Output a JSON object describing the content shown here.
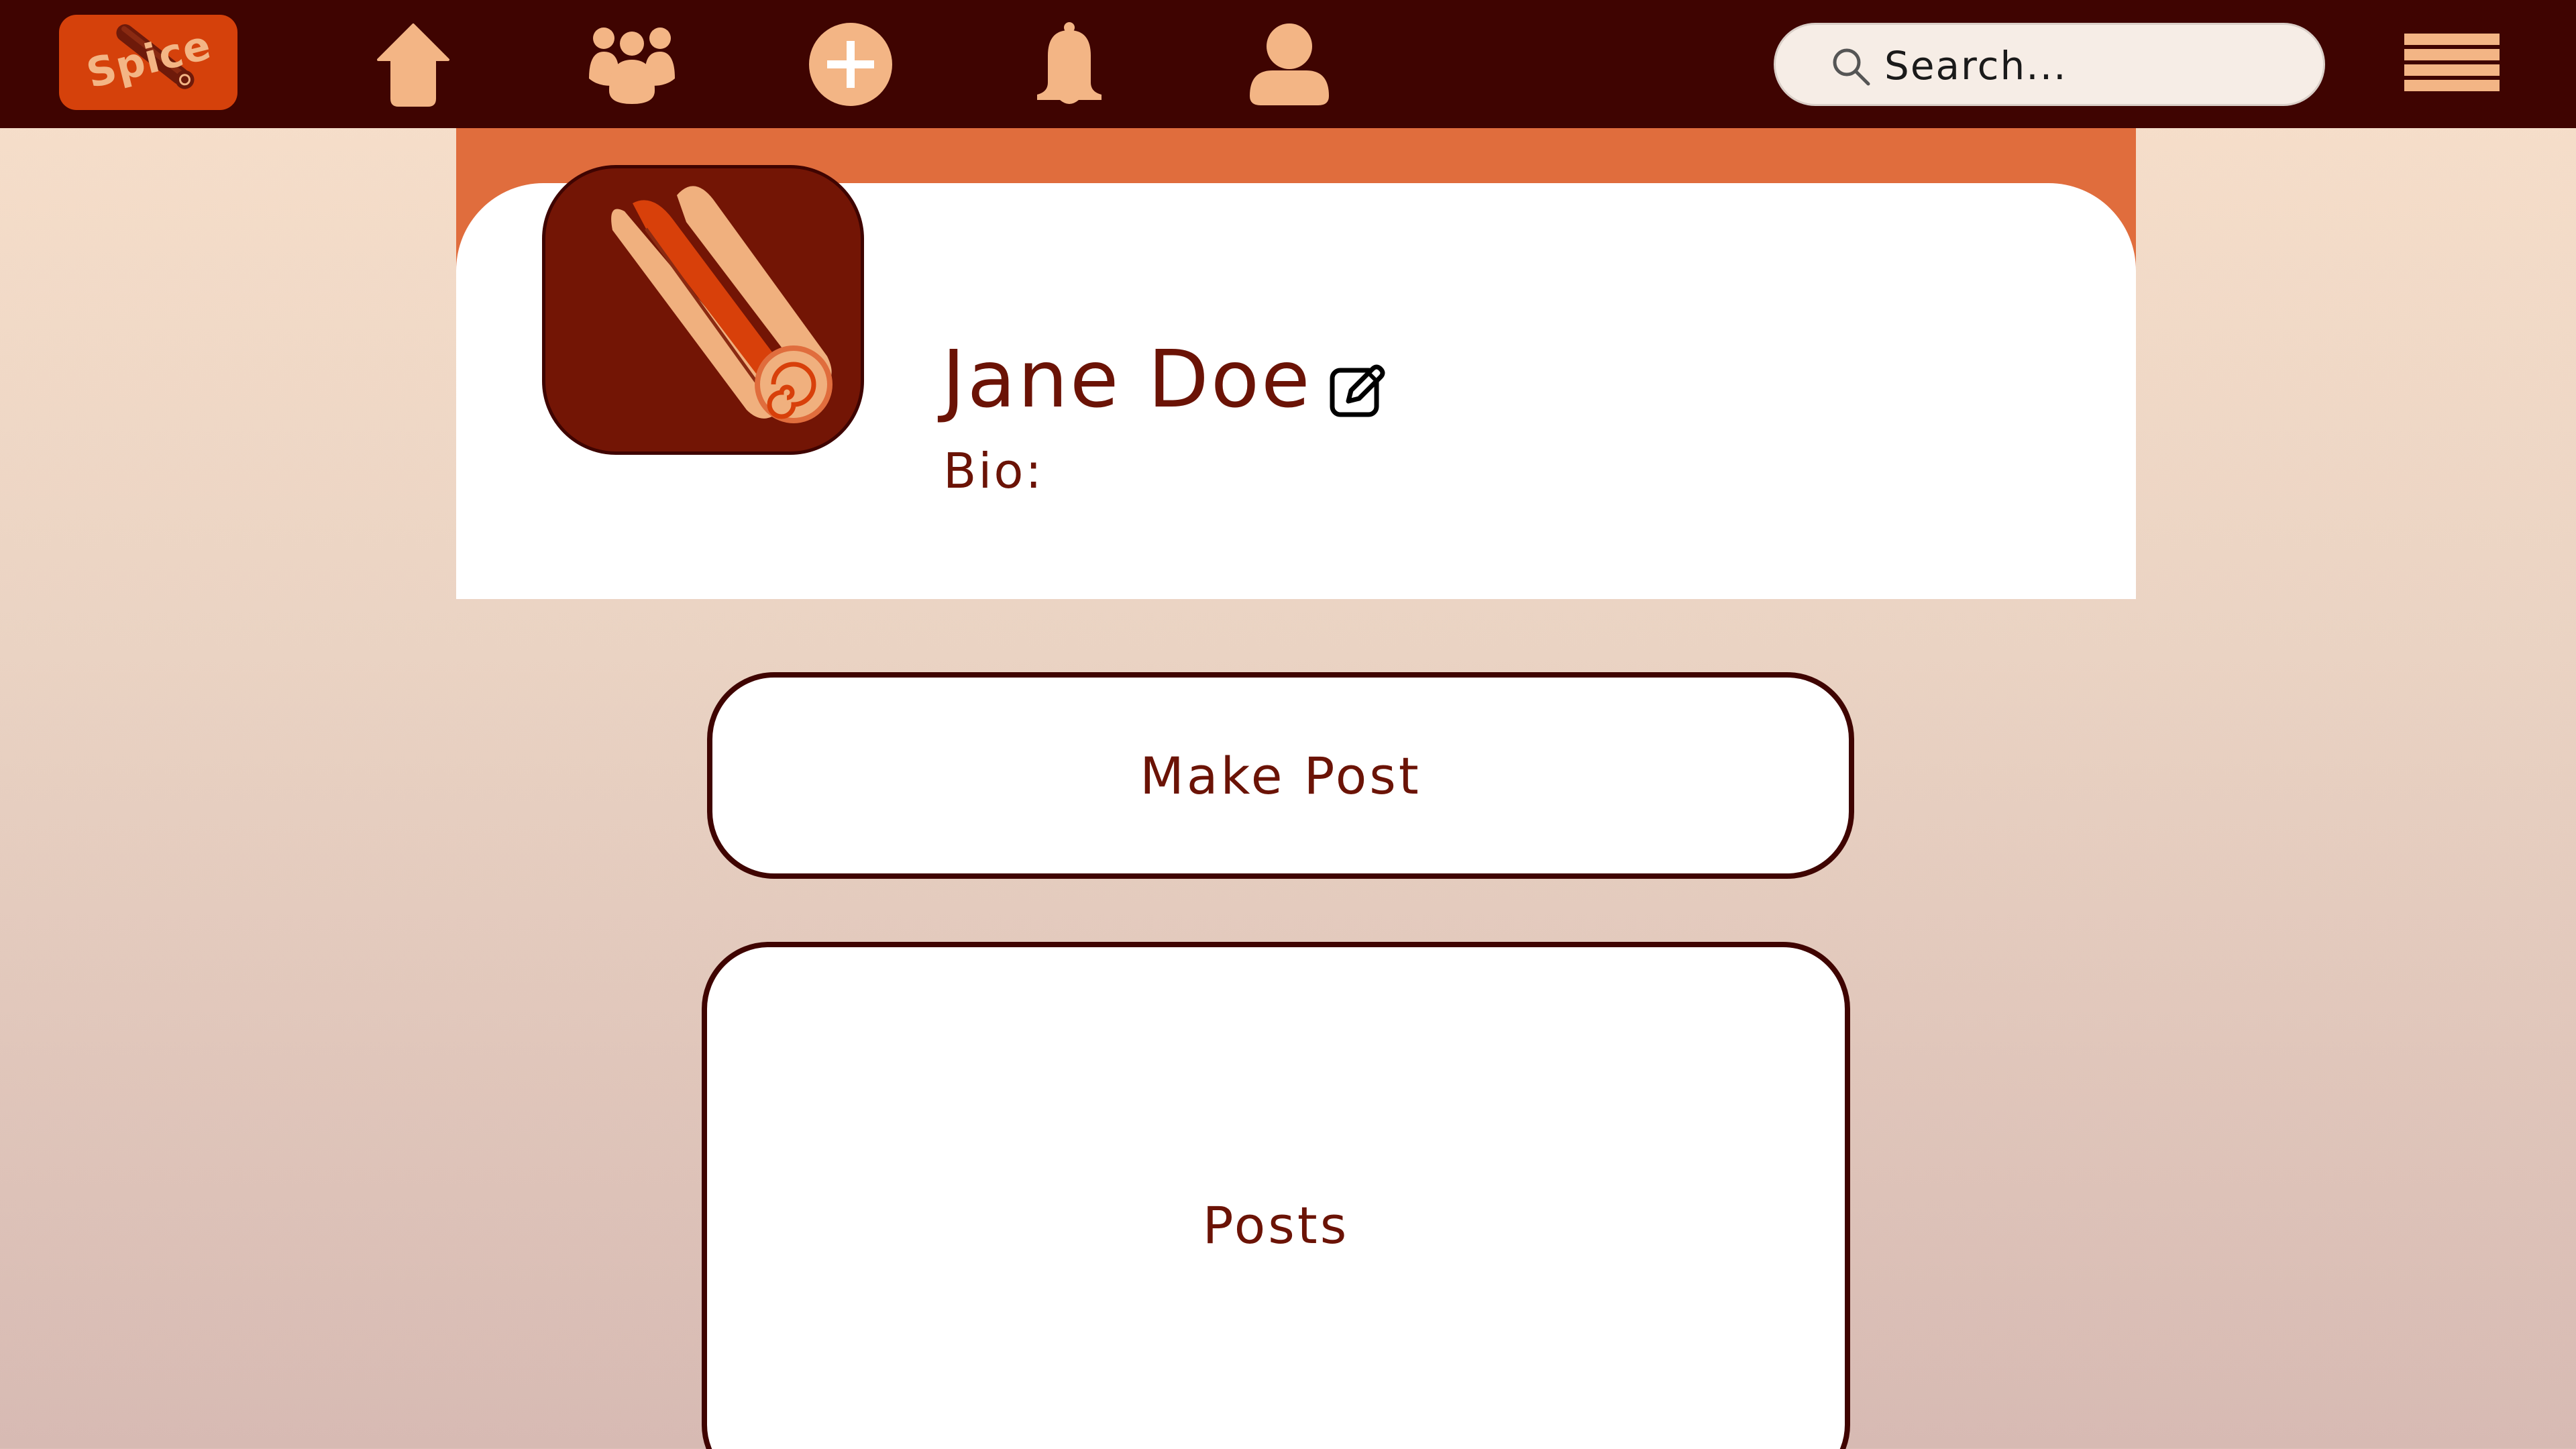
{
  "app": {
    "logo_text": "Spice"
  },
  "nav": {
    "items": [
      {
        "name": "home",
        "icon": "home-icon"
      },
      {
        "name": "groups",
        "icon": "people-icon"
      },
      {
        "name": "create",
        "icon": "plus-icon"
      },
      {
        "name": "notifications",
        "icon": "bell-icon"
      },
      {
        "name": "profile",
        "icon": "user-icon"
      }
    ],
    "menu_icon": "hamburger-menu-icon"
  },
  "search": {
    "placeholder": "Search...",
    "value": "",
    "icon": "search-icon"
  },
  "profile": {
    "name": "Jane Doe",
    "bio_label": "Bio:",
    "avatar_icon": "cinnamon-stick-icon",
    "edit_icon": "edit-icon"
  },
  "actions": {
    "make_post_label": "Make Post"
  },
  "posts": {
    "label": "Posts"
  },
  "colors": {
    "nav_background": "#3f0401",
    "icon_color": "#f3b585",
    "logo_background": "#d5410b",
    "banner": "#e06d3d",
    "avatar_background": "#731505",
    "text_primary": "#6b1306",
    "page_gradient_top": "#f8e0cb",
    "page_gradient_bottom": "#d7bab3"
  }
}
